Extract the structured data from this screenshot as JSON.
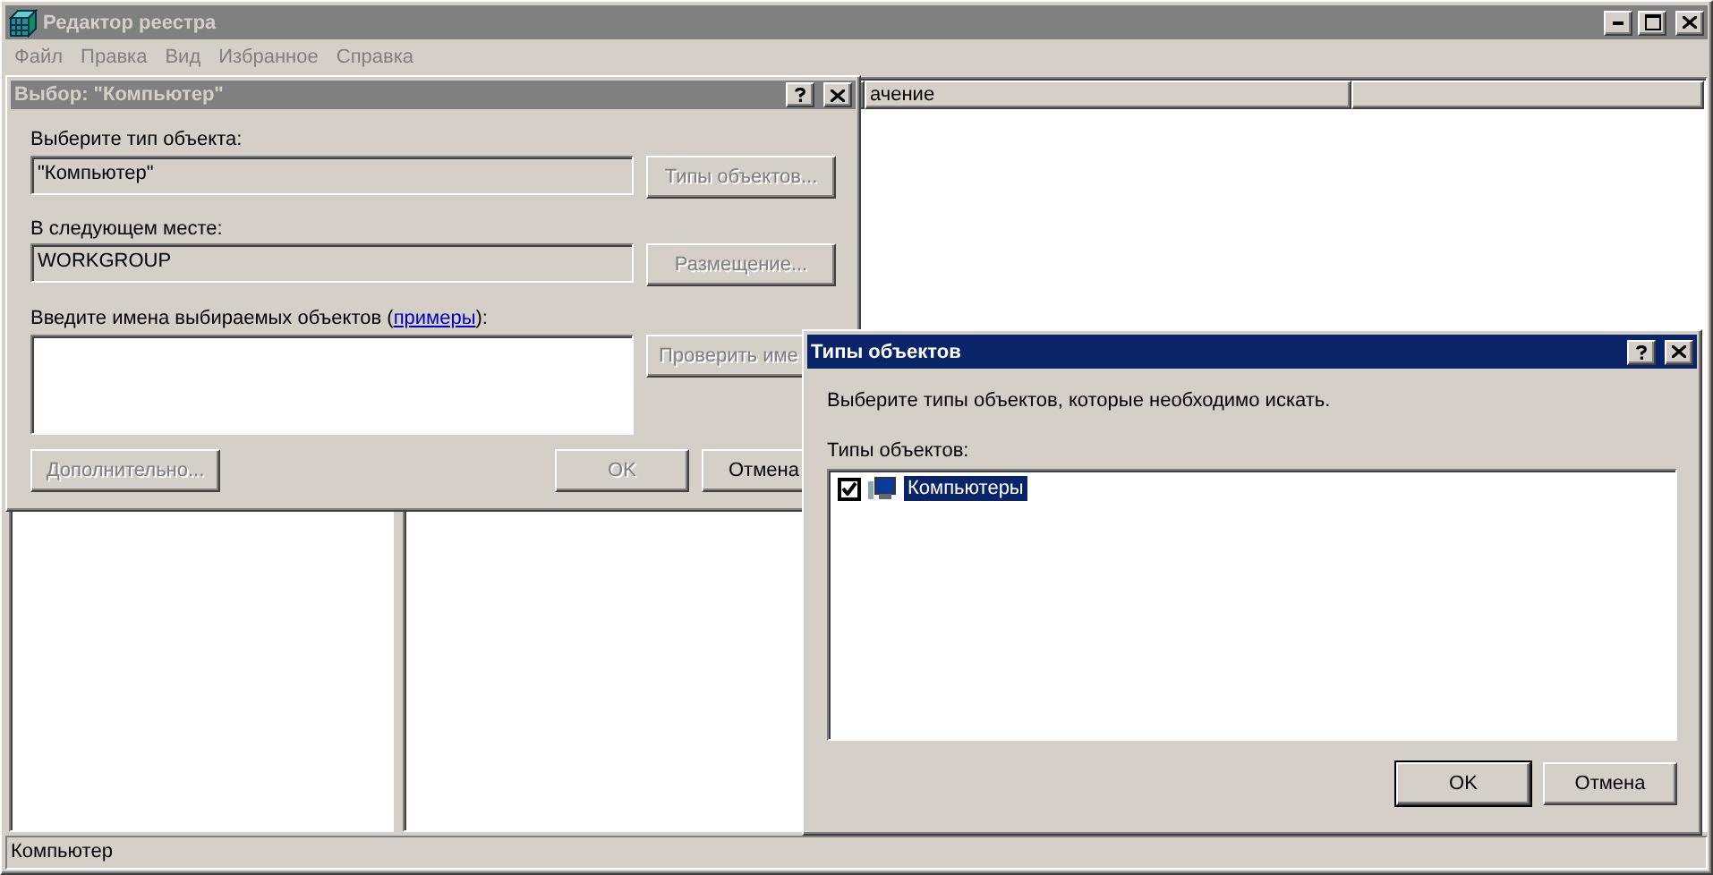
{
  "main_window": {
    "title": "Редактор реестра",
    "active": false,
    "menu": [
      "Файл",
      "Правка",
      "Вид",
      "Избранное",
      "Справка"
    ],
    "list_columns": [
      "ачение",
      ""
    ],
    "status_bar": "Компьютер"
  },
  "select_dialog": {
    "title": "Выбор: \"Компьютер\"",
    "active": false,
    "type_label": "Выберите тип объекта:",
    "type_value": "\"Компьютер\"",
    "type_button": {
      "label": "Типы объектов...",
      "disabled": true
    },
    "location_label": "В следующем месте:",
    "location_value": "WORKGROUP",
    "location_button": {
      "label": "Размещение...",
      "disabled": true
    },
    "names_label": "Введите имена выбираемых объектов (",
    "names_link": "примеры",
    "names_label_end": "):",
    "check_button": {
      "label": "Проверить име",
      "disabled": true
    },
    "advanced_button": {
      "label": "Дополнительно...",
      "disabled": true
    },
    "ok_button": {
      "label": "OK",
      "disabled": true
    },
    "cancel_button": {
      "label": "Отмена",
      "disabled": false
    }
  },
  "types_dialog": {
    "title": "Типы объектов",
    "active": true,
    "description": "Выберите типы объектов, которые необходимо искать.",
    "list_label": "Типы объектов:",
    "items": [
      {
        "label": "Компьютеры",
        "checked": true,
        "selected": true
      }
    ],
    "ok_button": {
      "label": "OK",
      "default": true
    },
    "cancel_button": {
      "label": "Отмена",
      "default": false
    }
  }
}
